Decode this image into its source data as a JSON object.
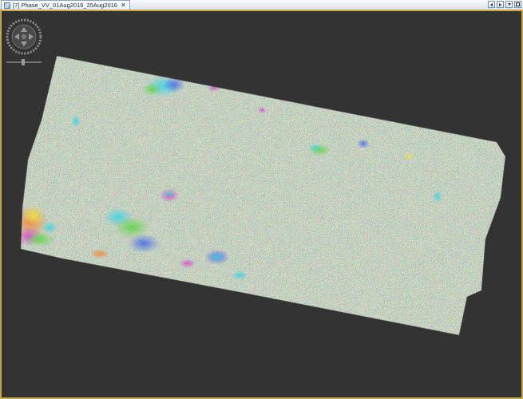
{
  "tab": {
    "index_label": "[7]",
    "title": "Phase_VV_01Aug2016_25Aug2016",
    "image_icon": "image-layer-icon",
    "close_icon": "close-icon"
  },
  "tab_controls": [
    {
      "name": "scroll-tabs-left-button",
      "icon": "triangle-left-icon"
    },
    {
      "name": "scroll-tabs-right-button",
      "icon": "triangle-right-icon"
    },
    {
      "name": "tab-list-dropdown-button",
      "icon": "triangle-down-icon"
    },
    {
      "name": "maximize-view-button",
      "icon": "square-icon"
    }
  ],
  "colors": {
    "background": "#333333",
    "view_border": "#c9a84a",
    "fringe_green": "#61d44b",
    "fringe_cyan": "#3fd3e4",
    "fringe_blue": "#4a6fe8",
    "fringe_magenta": "#d84ac9",
    "fringe_yellow": "#e8e24a",
    "fringe_orange": "#f2893a"
  },
  "navigation": {
    "pan_control": "pan-compass-icon",
    "zoom_slider": "zoom-slider-icon"
  },
  "image_layer": {
    "type": "interferometric-phase",
    "colormap": "rainbow-cyclic"
  }
}
